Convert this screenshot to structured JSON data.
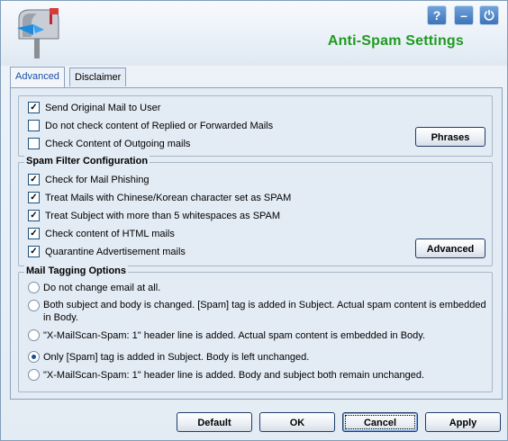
{
  "header": {
    "title": "Anti-Spam Settings",
    "buttons": {
      "help": "?",
      "minimize": "–",
      "power": "⏻"
    }
  },
  "tabs": [
    {
      "label": "Advanced",
      "active": true
    },
    {
      "label": "Disclaimer",
      "active": false
    }
  ],
  "general": {
    "options": [
      {
        "label": "Send Original Mail to User",
        "checked": true
      },
      {
        "label": "Do not check content of Replied or Forwarded Mails",
        "checked": false
      },
      {
        "label": "Check Content of Outgoing mails",
        "checked": false
      }
    ],
    "phrases_label": "Phrases"
  },
  "spam_filter": {
    "title": "Spam Filter Configuration",
    "options": [
      {
        "label": "Check for Mail Phishing",
        "checked": true
      },
      {
        "label": "Treat Mails with Chinese/Korean character set as SPAM",
        "checked": true
      },
      {
        "label": "Treat Subject with more than 5 whitespaces as SPAM",
        "checked": true
      },
      {
        "label": "Check content of HTML mails",
        "checked": true
      },
      {
        "label": "Quarantine Advertisement mails",
        "checked": true
      }
    ],
    "advanced_label": "Advanced"
  },
  "tagging": {
    "title": "Mail Tagging Options",
    "options": [
      {
        "label": "Do not change email at all.",
        "selected": false
      },
      {
        "label": "Both subject and body is changed.  [Spam] tag is added in Subject. Actual spam content is embedded in Body.",
        "selected": false
      },
      {
        "label": "\"X-MailScan-Spam: 1\" header line is added.  Actual spam content is embedded in Body.",
        "selected": false
      },
      {
        "label": "Only [Spam] tag is added in Subject. Body is left unchanged.",
        "selected": true
      },
      {
        "label": "\"X-MailScan-Spam: 1\" header line is added.  Body and subject both remain unchanged.",
        "selected": false
      }
    ]
  },
  "footer": {
    "default_label": "Default",
    "ok_label": "OK",
    "cancel_label": "Cancel",
    "apply_label": "Apply"
  },
  "colors": {
    "title": "#1f9a1f",
    "accent": "#3d74b8"
  }
}
